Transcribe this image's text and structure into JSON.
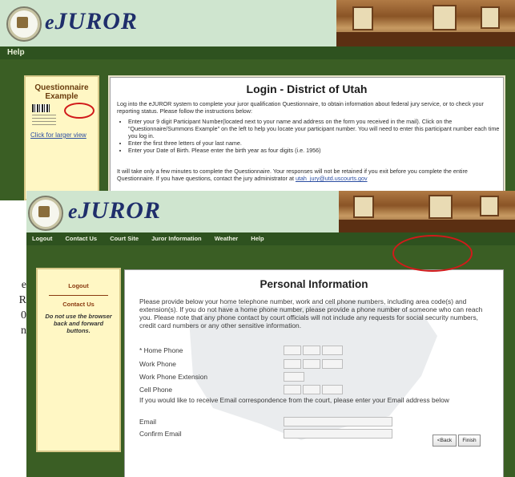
{
  "back_window": {
    "brand_e": "e",
    "brand_rest": "JUROR",
    "nav": [
      "Help"
    ],
    "sidebar": {
      "title": "Questionnaire Example",
      "link": "Click for larger view"
    },
    "title": "Login - District of Utah",
    "intro": "Log into the eJUROR system to complete your juror qualification Questionnaire, to obtain information about federal jury service, or to check your reporting status. Please follow the instructions below:",
    "bullets": [
      "Enter your 9 digit Participant Number(located next to your name and address on the form you received in the mail). Click on the \"Questionnaire/Summons Example\" on the left to help you locate your participant number. You will need to enter this participant number each time you log in.",
      "Enter the first three letters of your last name.",
      "Enter your Date of Birth. Please enter the birth year as four digits (i.e. 1956)"
    ],
    "footer_text": "It will take only a few minutes to complete the Questionnaire. Your responses will not be retained if you exit before you complete the entire Questionnaire. If you have questions, contact the jury administrator at",
    "footer_email": "utah_jury@utd.uscourts.gov"
  },
  "front_window": {
    "brand_e": "e",
    "brand_rest": "JUROR",
    "nav": [
      "Logout",
      "Contact Us",
      "Court Site",
      "Juror Information",
      "Weather",
      "Help"
    ],
    "sidebar": {
      "logout": "Logout",
      "contact": "Contact Us",
      "warning": "Do not use the browser back and forward buttons."
    },
    "title": "Personal Information",
    "intro": "Please provide below your home telephone number, work and cell phone numbers, including area code(s) and extension(s). If you do not have a home phone number, please provide a phone number of someone who can reach you. Please note that any phone contact by court officials will not include any requests for social security numbers, credit card numbers or any other sensitive information.",
    "fields": {
      "home_phone": "* Home Phone",
      "work_phone": "Work Phone",
      "work_ext": "Work Phone Extension",
      "cell_phone": "Cell Phone",
      "email_note": "If you would like to receive Email correspondence from the court, please enter your Email address below",
      "email": "Email",
      "confirm_email": "Confirm Email"
    },
    "buttons": {
      "back": "<Back",
      "finish": "Finish"
    }
  },
  "cropped_left_text": [
    "e",
    "R",
    "0",
    "n"
  ],
  "colors": {
    "header_bg": "#cfe5cf",
    "nav_bg": "#2e521f",
    "page_bg": "#3a5e24",
    "highlight": "#d11a1a"
  }
}
